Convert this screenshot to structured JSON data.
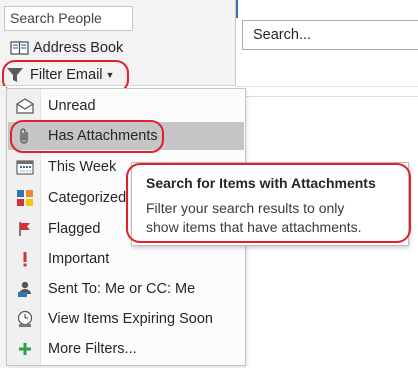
{
  "ribbon": {
    "search_people_placeholder": "Search People",
    "address_book_label": "Address Book",
    "filter_email_label": "Filter Email"
  },
  "search": {
    "placeholder": "Search..."
  },
  "menu": {
    "items": [
      {
        "label": "Unread",
        "icon": "envelope-open-icon"
      },
      {
        "label": "Has Attachments",
        "icon": "paperclip-icon"
      },
      {
        "label": "This Week",
        "icon": "calendar-week-icon"
      },
      {
        "label": "Categorized",
        "icon": "categories-grid-icon"
      },
      {
        "label": "Flagged",
        "icon": "flag-icon"
      },
      {
        "label": "Important",
        "icon": "exclamation-icon"
      },
      {
        "label": "Sent To: Me or CC: Me",
        "icon": "person-sent-icon"
      },
      {
        "label": "View Items Expiring Soon",
        "icon": "clock-expire-icon"
      },
      {
        "label": "More Filters...",
        "icon": "plus-icon"
      }
    ],
    "highlighted_index": 1
  },
  "tooltip": {
    "title": "Search for Items with Attachments",
    "body_line1": "Filter your search results to only",
    "body_line2": "show items that have attachments."
  },
  "colors": {
    "accent_red": "#e0202a",
    "menu_highlight": "#c5c5c5",
    "ribbon_bg": "#f3f3f3",
    "accent_blue": "#2e75b6"
  }
}
